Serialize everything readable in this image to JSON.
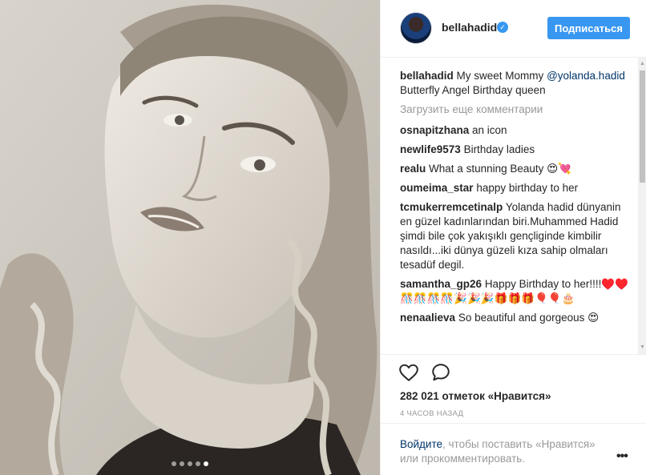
{
  "header": {
    "username": "bellahadid",
    "follow_label": "Подписаться"
  },
  "caption": {
    "author": "bellahadid",
    "text_before": "My sweet Mommy",
    "mention": "@yolanda.hadid",
    "text_after": "Butterfly Angel Birthday queen"
  },
  "load_more_label": "Загрузить еще комментарии",
  "comments": [
    {
      "author": "osnapitzhana",
      "text": "an icon"
    },
    {
      "author": "newlife9573",
      "text": "Birthday ladies"
    },
    {
      "author": "realu",
      "text": "What a stunning Beauty 😍💘"
    },
    {
      "author": "oumeima_star",
      "text": "happy birthday to her"
    },
    {
      "author": "tcmukerremcetinalp",
      "text": "Yolanda hadid dünyanin en güzel kadınlarından biri.Muhammed Hadid şimdi bile çok yakışıklı gençliginde kimbilir nasıldı...iki dünya güzeli kıza sahip olmaları tesadüf degil."
    },
    {
      "author": "samantha_gp26",
      "text": "Happy Birthday to her!!!!♥️♥️🎊🎊🎊🎊🎉🎉🎉🎁🎁🎁🎈🎈🎂"
    },
    {
      "author": "nenaalieva",
      "text": "So beautiful and gorgeous 😍"
    }
  ],
  "likes_label": "282 021 отметок «Нравится»",
  "time_label": "4 ЧАСОВ НАЗАД",
  "login": {
    "link": "Войдите",
    "text": ", чтобы поставить «Нравится» или прокомментировать."
  },
  "carousel": {
    "count": 5,
    "active_index": 4
  },
  "colors": {
    "accent": "#3897f0",
    "link": "#003569",
    "muted": "#999999"
  },
  "icons": {
    "verified": "verified-badge-icon",
    "like": "heart-icon",
    "comment": "comment-bubble-icon",
    "more": "more-options-icon"
  }
}
